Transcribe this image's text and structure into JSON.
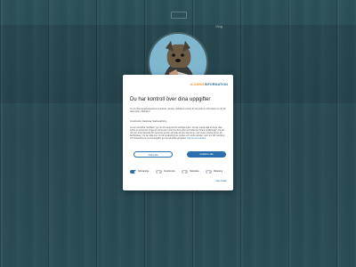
{
  "page": {
    "corner_text": "Vlog"
  },
  "cookie_dialog": {
    "brand": {
      "prefix": "•",
      "name_part1": "COOKIE",
      "name_part2": "INFORMATION"
    },
    "title": "Du har kontroll över dina uppgifter",
    "paragraph1": "Vi och våra samarbetspartners använder tekniker, däribland cookies för att samla in information om dig för olika syften, däribland:",
    "paragraph2": "Funktionella, Statistiska, Marknadsföring",
    "paragraph3": "Genom att klicka \"Godkänn\" ger du ditt samtycke till samtliga syften. Du kan också välja att ange vilka syften du samtycker till genom att kryssa i rutan bredvid syftet och klicka på \"Spara inställningar\". Du kan när som helst återkalla ditt samtycke genom att klicka på den lilla ikonen i det nedre vänstra hörnet på webbplatsen. Du kan läsa mer om vår användning av cookies och andra tekniker, samt om vår insamling och behandling av personuppgifter genom att klicka på länken.",
    "link_text": "Läs mer om cookies",
    "decline_label": "Neka alla",
    "accept_label": "Godkänn alla",
    "toggles": [
      {
        "label": "Nödvändiga",
        "on": true
      },
      {
        "label": "Funktionella",
        "on": false
      },
      {
        "label": "Statistiska",
        "on": false
      },
      {
        "label": "Marketing",
        "on": false
      }
    ],
    "details_label": "Visa detaljer",
    "colors": {
      "accent": "#2a6fb0",
      "brand_orange": "#f08c1b"
    }
  }
}
